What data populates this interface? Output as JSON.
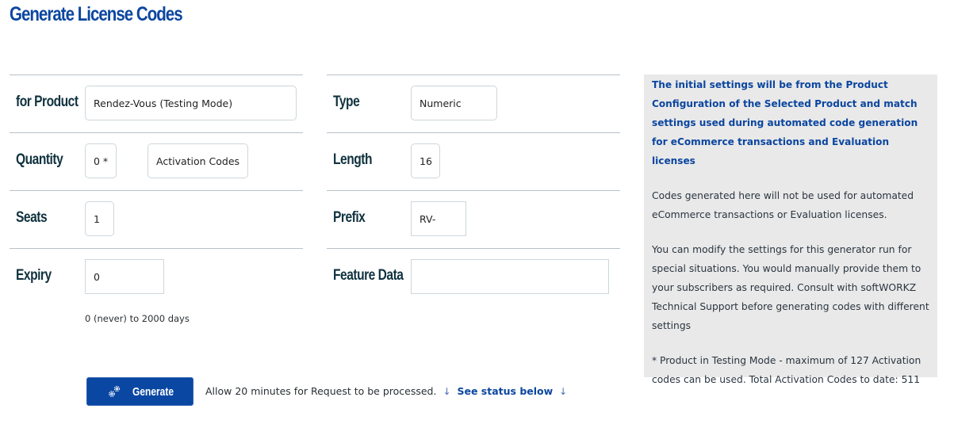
{
  "page": {
    "title": "Generate License Codes"
  },
  "form": {
    "product": {
      "label": "for Product",
      "value": "Rendez-Vous (Testing Mode)"
    },
    "quantity": {
      "label": "Quantity",
      "value": "0 *",
      "unit": "Activation Codes"
    },
    "seats": {
      "label": "Seats",
      "value": "1"
    },
    "expiry": {
      "label": "Expiry",
      "value": "0",
      "hint": "0 (never) to 2000 days"
    },
    "type": {
      "label": "Type",
      "value": "Numeric"
    },
    "length": {
      "label": "Length",
      "value": "16"
    },
    "prefix": {
      "label": "Prefix",
      "value": "RV-"
    },
    "feature_data": {
      "label": "Feature Data",
      "value": ""
    }
  },
  "actions": {
    "generate_label": "Generate",
    "generate_icon": "gears-icon",
    "status_note": "Allow 20 minutes for Request to be processed.",
    "arrow_glyph": "↓",
    "status_link": "See status below"
  },
  "info_panel": {
    "heading": "The initial settings will be from the Product Configuration of the Selected Product and match settings used during automated code generation for eCommerce transactions and Evaluation licenses",
    "paragraphs": [
      "Codes generated here will not be used for automated eCommerce transactions or Evaluation licenses.",
      "You can modify the settings for this generator run for special situations. You would manually provide them to your subscribers as required. Consult with softWORKZ Technical Support before generating codes with different settings",
      "* Product in Testing Mode - maximum of 127 Activation codes can be used. Total Activation Codes to date: 511"
    ]
  },
  "colors": {
    "brand_blue": "#0b46a0",
    "label_dark": "#10323f",
    "panel_bg": "#e9e9e9",
    "divider": "#b7c1c8"
  }
}
